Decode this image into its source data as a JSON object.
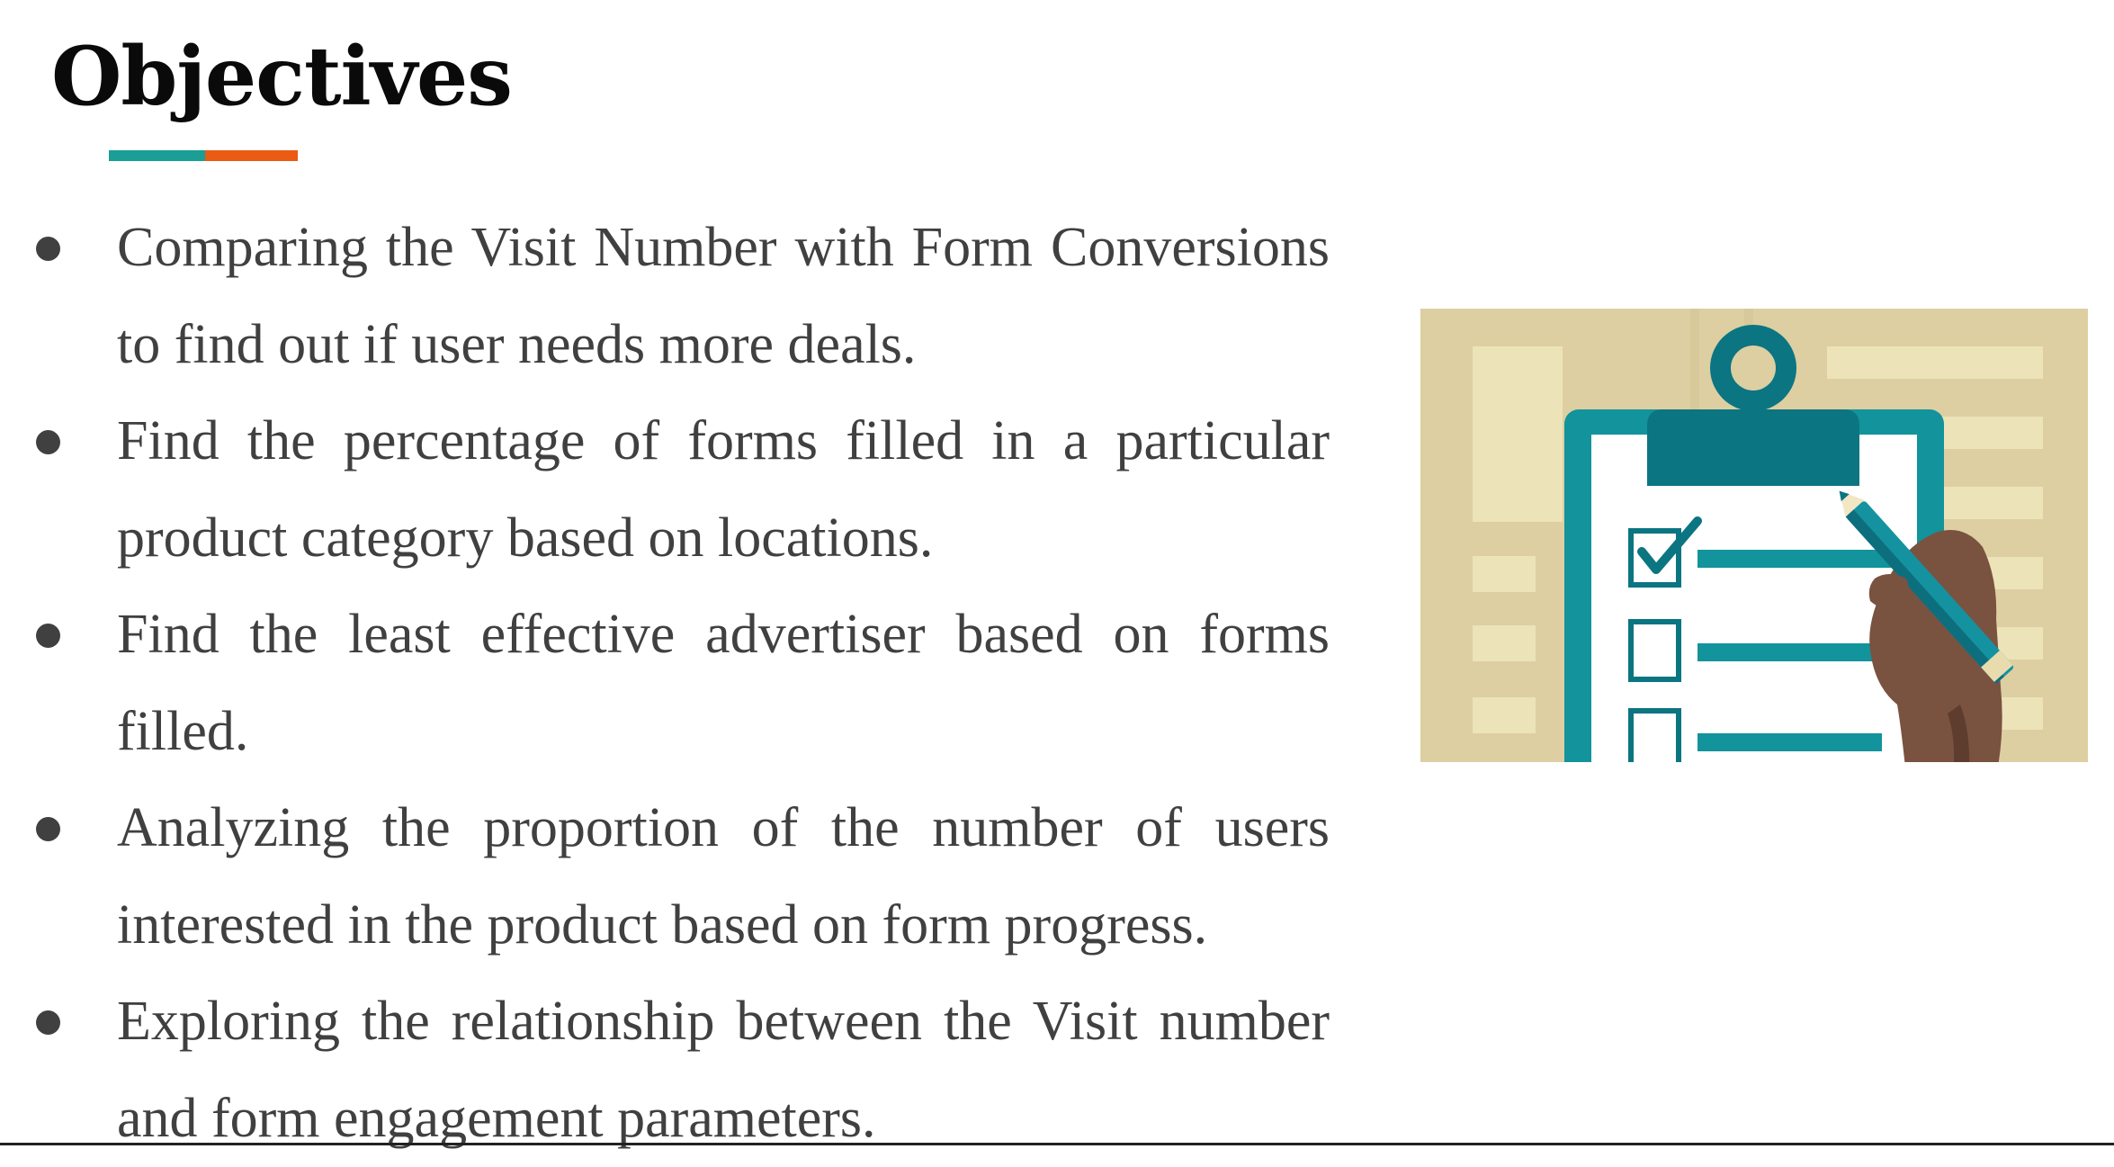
{
  "slide": {
    "title": "Objectives",
    "accent_colors": {
      "teal": "#1a9e96",
      "orange": "#ea5b13"
    },
    "bullets": [
      {
        "text": "Comparing the Visit Number with Form Conversions to find out if user needs more deals."
      },
      {
        "text": "Find the percentage of forms filled in a particular product category based on locations."
      },
      {
        "text": "Find the least effective advertiser based on forms filled."
      },
      {
        "text": "Analyzing the proportion of the number of users interested in the product based on form progress."
      },
      {
        "text": "Exploring the relationship between  the Visit number and form engagement parameters."
      }
    ],
    "illustration": {
      "icon": "clipboard-checklist-icon",
      "colors": {
        "background": "#ddcfa1",
        "panel_light": "#ede3b9",
        "clipboard": "#13939b",
        "clip_dark": "#0b7582",
        "paper": "#ffffff",
        "hand": "#7a5240",
        "pencil": "#1592a0"
      }
    }
  }
}
